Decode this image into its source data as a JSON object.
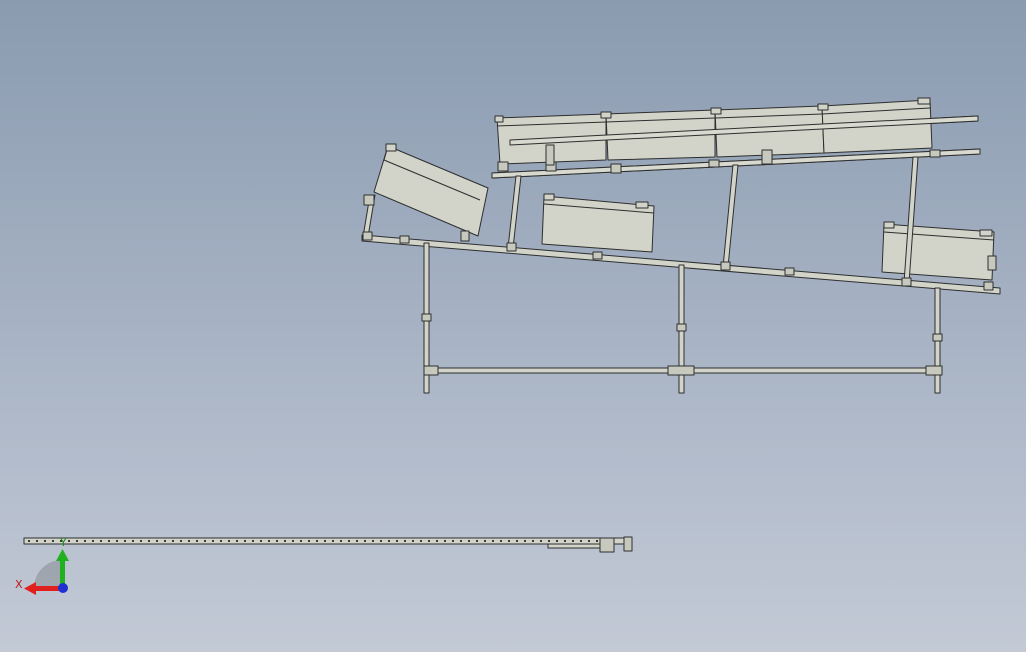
{
  "viewport": {
    "background_top": "#8a9bb0",
    "background_bottom": "#c3cad6"
  },
  "model": {
    "name_icon": "conveyor-rack-assembly",
    "part_fill": "#d2d4c9",
    "edge_color": "#2e2e2e",
    "bin_count": 7
  },
  "triad": {
    "x_label": "X",
    "y_label": "Y",
    "x_color": "#e0201c",
    "y_color": "#20b020",
    "z_color": "#2030d0"
  }
}
